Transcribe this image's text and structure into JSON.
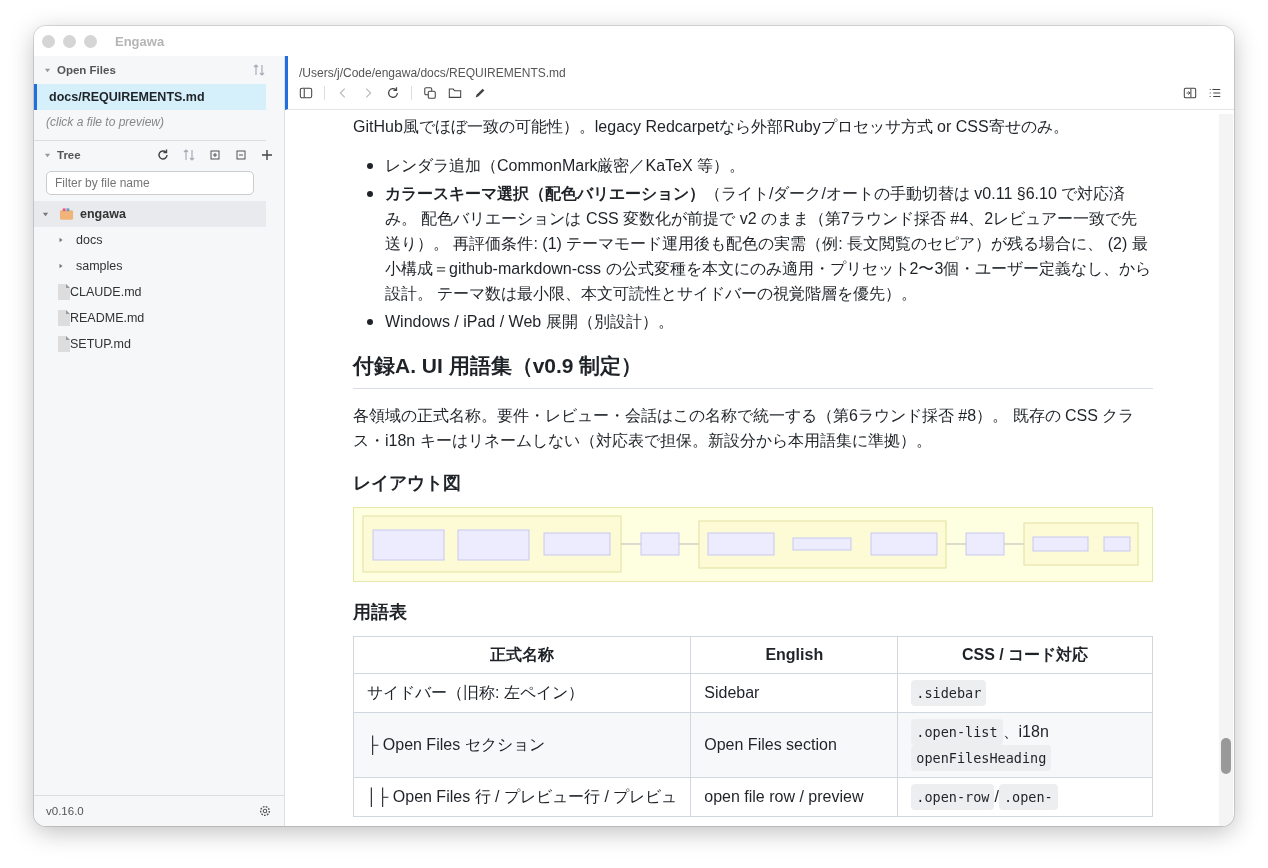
{
  "window": {
    "title": "Engawa"
  },
  "sidebar": {
    "open_files": {
      "title": "Open Files",
      "expanded": true,
      "items": [
        {
          "label": "docs/REQUIREMENTS.md",
          "selected": true
        }
      ],
      "hint": "(click a file to preview)"
    },
    "tree": {
      "title": "Tree",
      "expanded": true,
      "filter": {
        "placeholder": "Filter by file name"
      },
      "items": [
        {
          "label": "engawa",
          "kind": "root",
          "expanded": true,
          "selected": true,
          "children": [
            {
              "label": "docs",
              "kind": "folder",
              "expanded": false,
              "selected": false
            },
            {
              "label": "samples",
              "kind": "folder",
              "expanded": false,
              "selected": false
            },
            {
              "label": "CLAUDE.md",
              "kind": "file",
              "selected": false
            },
            {
              "label": "README.md",
              "kind": "file",
              "selected": false
            },
            {
              "label": "SETUP.md",
              "kind": "file",
              "selected": false
            }
          ]
        }
      ]
    },
    "version": "v0.16.0"
  },
  "pane": {
    "path": "/Users/j/Code/engawa/docs/REQUIREMENTS.md",
    "blocks": [
      {
        "kind": "para",
        "text": "GitHub風でほぼ一致の可能性）。legacy Redcarpetなら外部Rubyプロセッサ方式 or CSS寄せのみ。"
      },
      {
        "kind": "list",
        "items": [
          "レンダラ追加（CommonMark厳密／KaTeX 等）。",
          "**カラースキーマ選択（配色バリエーション）**（ライト/ダーク/オートの手動切替は v0.11 §6.10 で対応済み。 配色バリエーションは CSS 変数化が前提で v2 のまま（第7ラウンド採否 #4、2レビュアー一致で先送り）。 再評価条件: (1) テーマモード運用後も配色の実需（例: 長文閲覧のセピア）が残る場合に、 (2) 最小構成＝github-markdown-css の公式変種を本文にのみ適用・プリセット2〜3個・ユーザー定義なし、から設計。 テーマ数は最小限、本文可読性とサイドバーの視覚階層を優先）。",
          "Windows / iPad / Web 展開（別設計）。"
        ]
      },
      {
        "kind": "h2",
        "text": "付録A. UI 用語集（v0.9 制定）"
      },
      {
        "kind": "para",
        "text": "各領域の正式名称。要件・レビュー・会話はこの名称で統一する（第6ラウンド採否 #8）。 既存の CSS クラス・i18n キーはリネームしない（対応表で担保。新設分から本用語集に準拠）。"
      },
      {
        "kind": "h3",
        "text": "レイアウト図"
      },
      {
        "kind": "diagram"
      },
      {
        "kind": "h3",
        "text": "用語表"
      },
      {
        "kind": "table",
        "columns": [
          "正式名称",
          "English",
          "CSS / コード対応"
        ],
        "rows": [
          [
            [
              {
                "kind": "text",
                "text": "サイドバー（旧称: 左ペイン）"
              }
            ],
            [
              {
                "kind": "text",
                "text": "Sidebar"
              }
            ],
            [
              {
                "kind": "code",
                "text": ".sidebar"
              }
            ]
          ],
          [
            [
              {
                "kind": "text",
                "text": "├ Open Files セクション"
              }
            ],
            [
              {
                "kind": "text",
                "text": "Open Files section"
              }
            ],
            [
              {
                "kind": "code",
                "text": ".open-list"
              },
              {
                "kind": "text",
                "text": "、i18n"
              },
              {
                "kind": "code",
                "text": "openFilesHeading"
              }
            ]
          ],
          [
            [
              {
                "kind": "text",
                "text": "│├ Open Files 行 / プレビュー行 / プレビュ"
              }
            ],
            [
              {
                "kind": "text",
                "text": "open file row / preview"
              }
            ],
            [
              {
                "kind": "code",
                "text": ".open-row"
              },
              {
                "kind": "text",
                "text": " / "
              },
              {
                "kind": "code",
                "text": ".open-"
              }
            ]
          ]
        ]
      }
    ]
  }
}
